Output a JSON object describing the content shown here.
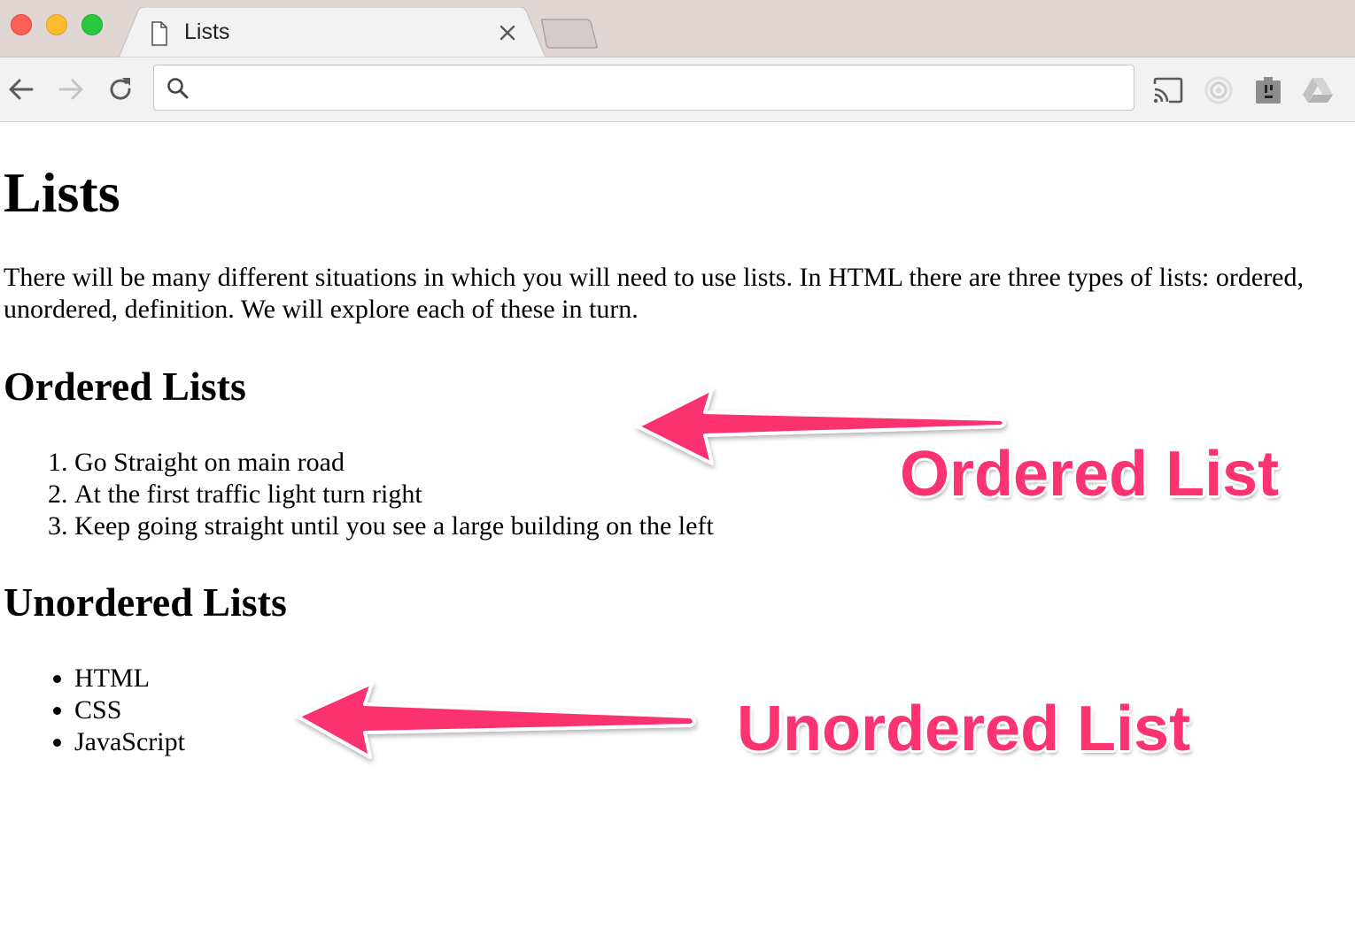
{
  "window": {
    "tab_title": "Lists",
    "tab_icon": "page-icon",
    "close_icon": "close-icon"
  },
  "toolbar": {
    "back_icon": "back-arrow-icon",
    "forward_icon": "forward-arrow-icon",
    "reload_icon": "reload-icon",
    "search_icon": "search-icon",
    "omnibox_value": "",
    "extensions": [
      "cast-icon",
      "extension-icon",
      "extension-icon",
      "google-drive-icon"
    ]
  },
  "page": {
    "title": "Lists",
    "intro": "There will be many different situations in which you will need to use lists. In HTML there are three types of lists: ordered, unordered, definition. We will explore each of these in turn.",
    "ordered_heading": "Ordered Lists",
    "ordered_items": [
      "Go Straight on main road",
      "At the first traffic light turn right",
      "Keep going straight until you see a large building on the left"
    ],
    "unordered_heading": "Unordered Lists",
    "unordered_items": [
      "HTML",
      "CSS",
      "JavaScript"
    ]
  },
  "annotations": {
    "ordered_label": "Ordered List",
    "unordered_label": "Unordered List",
    "color": "#fb3370"
  }
}
